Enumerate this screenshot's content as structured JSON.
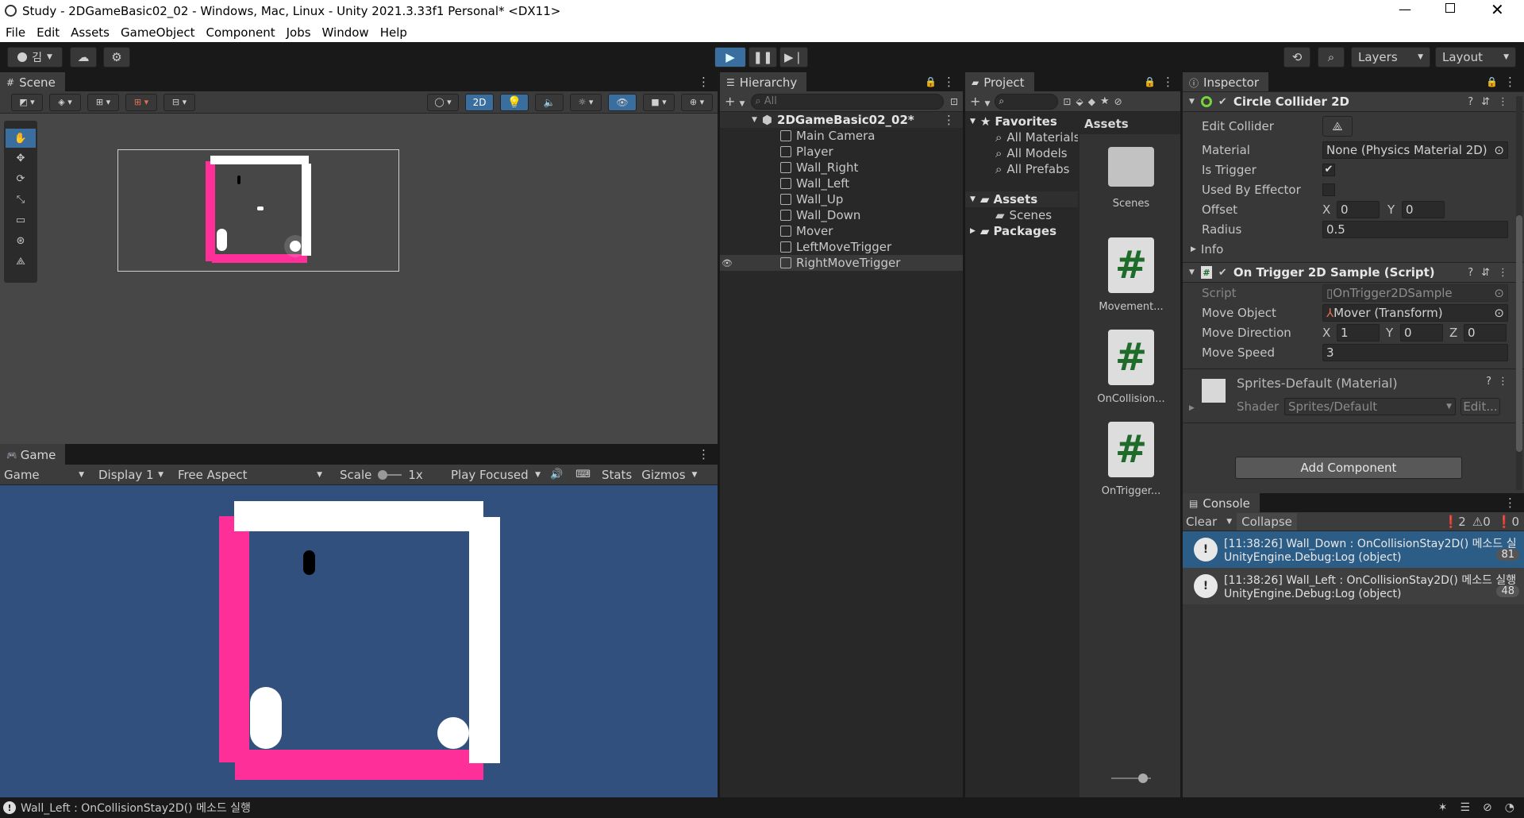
{
  "window": {
    "title": "Study - 2DGameBasic02_02 - Windows, Mac, Linux - Unity 2021.3.33f1 Personal* <DX11>"
  },
  "menu": [
    "File",
    "Edit",
    "Assets",
    "GameObject",
    "Component",
    "Jobs",
    "Window",
    "Help"
  ],
  "toolbar": {
    "account": "김",
    "layers": "Layers",
    "layout": "Layout"
  },
  "scene": {
    "tab": "Scene",
    "mode_2d": "2D"
  },
  "game": {
    "tab": "Game",
    "view": "Game",
    "display": "Display 1",
    "aspect": "Free Aspect",
    "scale_label": "Scale",
    "scale_value": "1x",
    "play_mode": "Play Focused",
    "stats": "Stats",
    "gizmos": "Gizmos"
  },
  "hierarchy": {
    "tab": "Hierarchy",
    "search_placeholder": "All",
    "scene_name": "2DGameBasic02_02*",
    "items": [
      "Main Camera",
      "Player",
      "Wall_Right",
      "Wall_Left",
      "Wall_Up",
      "Wall_Down",
      "Mover",
      "LeftMoveTrigger",
      "RightMoveTrigger"
    ]
  },
  "project": {
    "tab": "Project",
    "favorites": "Favorites",
    "fav_items": [
      "All Materials",
      "All Models",
      "All Prefabs"
    ],
    "assets_root": "Assets",
    "asset_children": [
      "Scenes"
    ],
    "packages": "Packages",
    "assets_header": "Assets",
    "asset_tiles": [
      {
        "label": "Scenes",
        "type": "folder"
      },
      {
        "label": "Movement...",
        "type": "script"
      },
      {
        "label": "OnCollision...",
        "type": "script"
      },
      {
        "label": "OnTrigger...",
        "type": "script"
      }
    ]
  },
  "inspector": {
    "tab": "Inspector",
    "collider": {
      "title": "Circle Collider 2D",
      "edit_collider": "Edit Collider",
      "material_label": "Material",
      "material_value": "None (Physics Material 2D)",
      "is_trigger": "Is Trigger",
      "used_by_effector": "Used By Effector",
      "offset": "Offset",
      "offset_x": "0",
      "offset_y": "0",
      "radius": "Radius",
      "radius_value": "0.5",
      "info": "Info"
    },
    "script": {
      "title": "On Trigger 2D Sample (Script)",
      "script_label": "Script",
      "script_value": "OnTrigger2DSample",
      "move_object": "Move Object",
      "move_object_value": "Mover (Transform)",
      "move_direction": "Move Direction",
      "dir_x": "1",
      "dir_y": "0",
      "dir_z": "0",
      "move_speed": "Move Speed",
      "move_speed_value": "3"
    },
    "material": {
      "title": "Sprites-Default (Material)",
      "shader_label": "Shader",
      "shader_value": "Sprites/Default",
      "edit": "Edit..."
    },
    "add_component": "Add Component"
  },
  "console": {
    "tab": "Console",
    "clear": "Clear",
    "collapse": "Collapse",
    "count_log": "2",
    "count_warn": "0",
    "count_err": "0",
    "entries": [
      {
        "line1": "[11:38:26] Wall_Down : OnCollisionStay2D() 메소드 실",
        "line2": "UnityEngine.Debug:Log (object)",
        "count": "81"
      },
      {
        "line1": "[11:38:26] Wall_Left : OnCollisionStay2D() 메소드 실행",
        "line2": "UnityEngine.Debug:Log (object)",
        "count": "48"
      }
    ]
  },
  "status": {
    "message": "Wall_Left : OnCollisionStay2D() 메소드 실행"
  },
  "colors": {
    "pink": "#ff2f9a",
    "white": "#ffffff",
    "game_bg": "#31507d",
    "scene_bg": "#474747",
    "accent": "#2c5d87"
  }
}
